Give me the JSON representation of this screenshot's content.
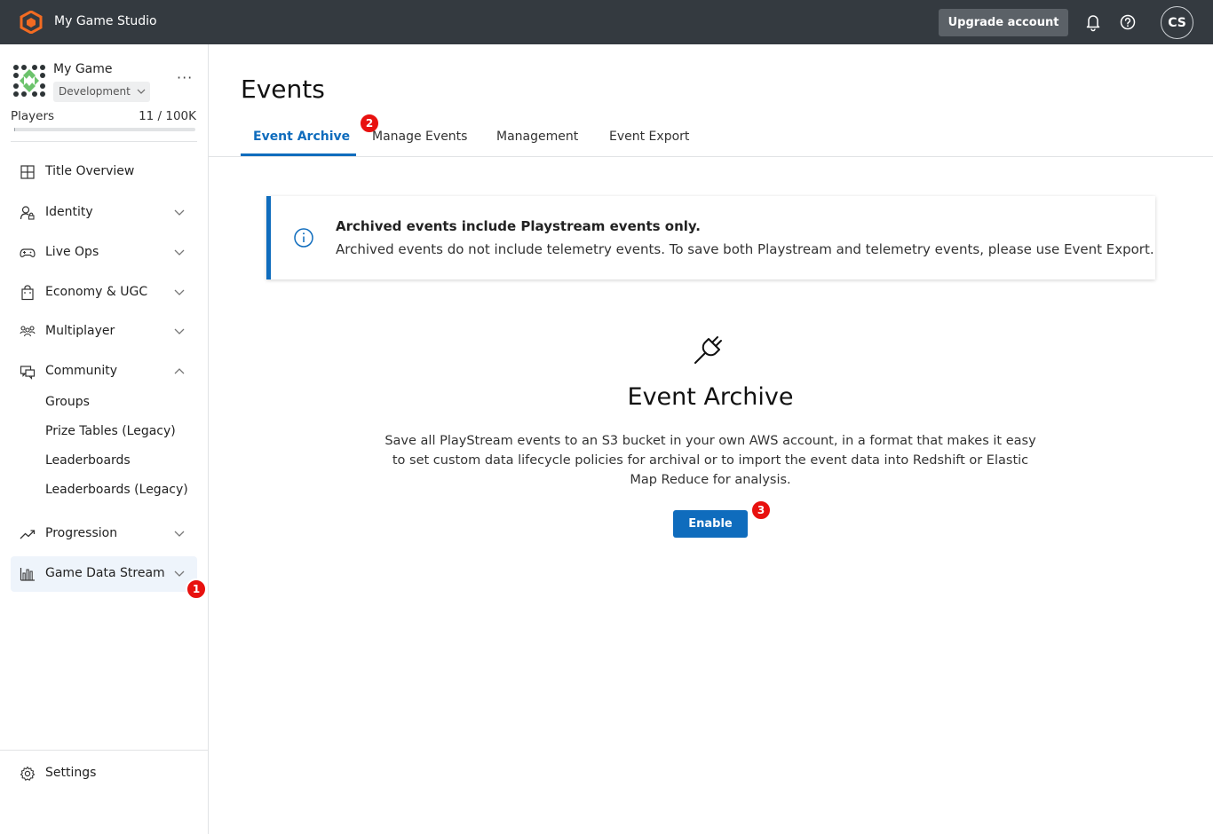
{
  "topbar": {
    "studio_name": "My Game Studio",
    "upgrade_label": "Upgrade account",
    "avatar_initials": "CS"
  },
  "sidebar": {
    "game_name": "My Game",
    "environment": "Development",
    "more": "···",
    "players_label": "Players",
    "players_count": "11 / 100K",
    "players_fill": 0.00011,
    "nav": [
      {
        "label": "Title Overview",
        "icon": "grid-icon"
      },
      {
        "label": "Identity",
        "icon": "identity-icon"
      },
      {
        "label": "Live Ops",
        "icon": "gamepad-icon"
      },
      {
        "label": "Economy & UGC",
        "icon": "bag-icon"
      },
      {
        "label": "Multiplayer",
        "icon": "people-icon"
      },
      {
        "label": "Community",
        "icon": "community-icon"
      },
      {
        "label": "Progression",
        "icon": "trend-icon"
      },
      {
        "label": "Game Data Stream",
        "icon": "bar-chart-icon"
      }
    ],
    "community_sub": [
      "Groups",
      "Prize Tables (Legacy)",
      "Leaderboards",
      "Leaderboards (Legacy)"
    ],
    "settings_label": "Settings"
  },
  "badges": [
    "1",
    "2",
    "3"
  ],
  "main": {
    "title": "Events",
    "tabs": [
      "Event Archive",
      "Manage Events",
      "Management",
      "Event Export"
    ],
    "notice_title": "Archived events include Playstream events only.",
    "notice_body": "Archived events do not include telemetry events. To save both Playstream and telemetry events, please use Event Export.",
    "empty_title": "Event Archive",
    "empty_desc": "Save all PlayStream events to an S3 bucket in your own AWS account, in a format that makes it easy to set custom data lifecycle policies for archival or to import the event data into Redshift or Elastic Map Reduce for analysis.",
    "enable_label": "Enable"
  },
  "colors": {
    "topbar": "#343a40",
    "accent": "#0f6cbd",
    "badge": "#e8110f",
    "logo": "#f26b22"
  }
}
